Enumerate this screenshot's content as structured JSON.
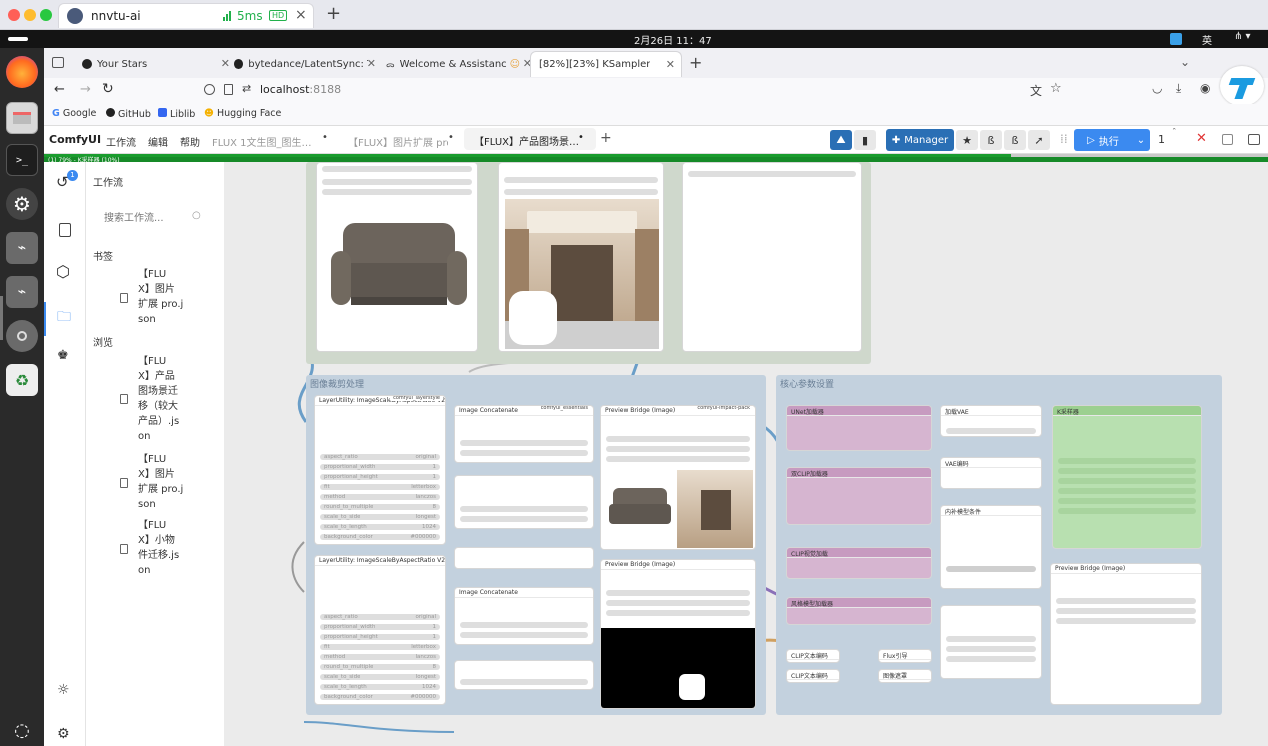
{
  "remote": {
    "session_name": "nnvtu-ai",
    "latency": "5ms",
    "quality_badge": "HD",
    "add_tab": "+"
  },
  "os": {
    "datetime": "2月26日 11：47",
    "ime": "英"
  },
  "browser": {
    "tabs": [
      {
        "label": "Your Stars",
        "icon": "github-icon"
      },
      {
        "label": "bytedance/LatentSync: Ta",
        "icon": "github-icon"
      },
      {
        "label": "Welcome & Assistance",
        "icon": "ollama-icon"
      },
      {
        "label": "[82%][23%] KSampler",
        "icon": ""
      }
    ],
    "new_tab": "+",
    "url_host": "localhost",
    "url_port": ":8188",
    "bookmarks": [
      "Google",
      "GitHub",
      "Liblib",
      "Hugging Face"
    ]
  },
  "comfy": {
    "logo": "ComfyUI",
    "menus": [
      "工作流",
      "编辑",
      "帮助"
    ],
    "workflow_tabs": [
      "FLUX 1文生图_图生…",
      "【FLUX】图片扩展 pro",
      "【FLUX】产品图场景…"
    ],
    "add_tab": "+",
    "manager_label": "Manager",
    "run_label": "执行",
    "queue_count": "1",
    "status_text": "(1) 79% - K采样器 (10%)",
    "progress": 0.79
  },
  "sidebar": {
    "workflow_label": "工作流",
    "badge": "1",
    "search_placeholder": "搜索工作流...",
    "bookmarks_header": "书签",
    "browse_header": "浏览",
    "bookmark_items": [
      [
        "【FLU",
        "X】图片",
        "扩展 pro.j",
        "son"
      ]
    ],
    "browse_items": [
      [
        "【FLU",
        "X】产品",
        "图场景迁",
        "移（较大",
        "产品）.js",
        "on"
      ],
      [
        "【FLU",
        "X】图片",
        "扩展 pro.j",
        "son"
      ],
      [
        "【FLU",
        "X】小物",
        "件迁移.js",
        "on"
      ]
    ]
  },
  "canvas": {
    "group_titles": [
      "图像裁剪处理",
      "核心参数设置"
    ],
    "nodes": {
      "upscale_a": "LayerUtility: ImageScaleByAspectRatio V2",
      "upscale_b": "LayerUtility: ImageScaleByAspectRatio V2",
      "concat_a": "Image Concatenate",
      "concat_b": "Image Concatenate",
      "preview_a": "Preview Bridge (Image)",
      "preview_b": "Preview Bridge (Image)",
      "preview_c": "Preview Bridge (Image)",
      "layerutility_tag": "comfyui_layerstyle",
      "essentials_tag": "comfyui_essentials",
      "impact_tag": "comfyui-impact-pack",
      "vae": "加载VAE",
      "vae_encode": "VAE编码",
      "sampler": "K采样器",
      "inpaint": "内补模型条件",
      "clip_a": "CLIP文本编码",
      "clip_b": "CLIP文本编码",
      "flux": "Flux引导",
      "image_crop": "图像遮罩",
      "dual_clip": "双CLIP加载器",
      "unet": "UNet加载器",
      "clip_vision": "CLIP视觉加载",
      "style_model": "风格模型加载器"
    },
    "field_rows": [
      "aspect_ratio",
      "proportional_width",
      "proportional_height",
      "fit",
      "method",
      "round_to_multiple",
      "scale_to_side",
      "scale_to_length",
      "background_color"
    ],
    "values": [
      "original",
      "1",
      "1",
      "letterbox",
      "lanczos",
      "8",
      "longest",
      "1024",
      "#000000"
    ]
  }
}
